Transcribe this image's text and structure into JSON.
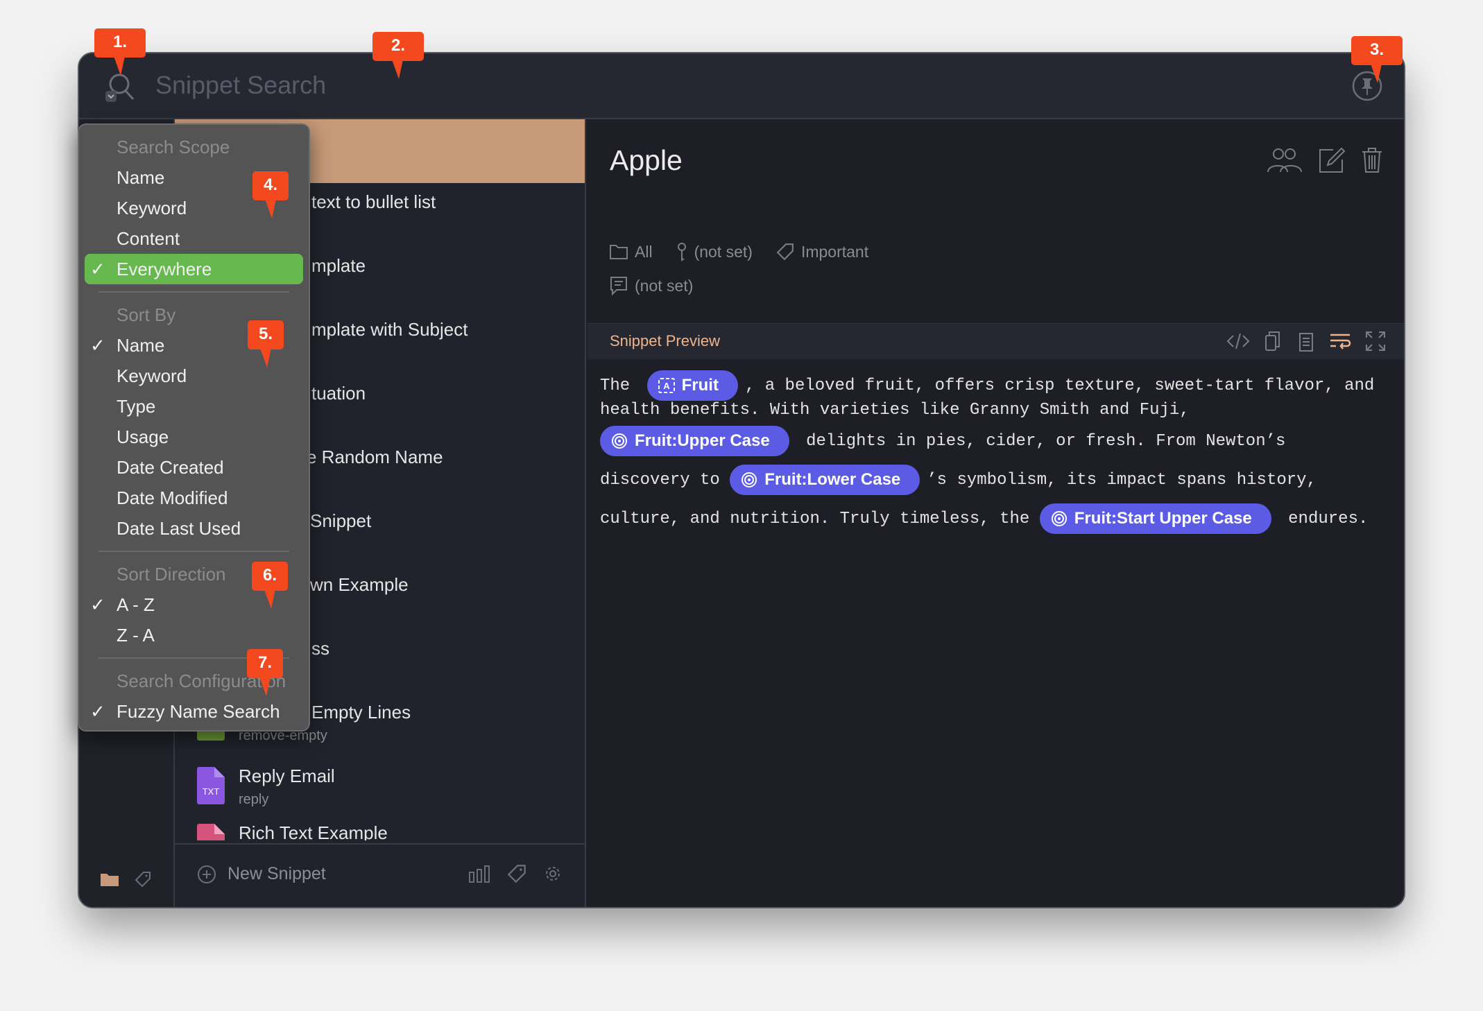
{
  "header": {
    "search_placeholder": "Snippet Search"
  },
  "list": {
    "items": [
      {
        "title": "",
        "selected": true
      },
      {
        "title": "text to bullet list"
      },
      {
        "title": "mplate"
      },
      {
        "title": "mplate with Subject"
      },
      {
        "title": "tuation"
      },
      {
        "title": "e Random Name"
      },
      {
        "title": "Snippet"
      },
      {
        "title": "wn Example"
      },
      {
        "title": "ss"
      },
      {
        "title": "Empty Lines",
        "subtitle": "remove-empty",
        "icon": "green-file-icon"
      },
      {
        "title": "Reply Email",
        "subtitle": "reply",
        "icon": "txt-file-icon",
        "icon_label": "TXT"
      },
      {
        "title": "Rich Text Example",
        "icon": "rich-text-file-icon"
      }
    ],
    "new_snippet": "New Snippet"
  },
  "detail": {
    "title": "Apple",
    "folder": "All",
    "keyword": "(not set)",
    "tag": "Important",
    "description": "(not set)",
    "preview_title": "Snippet Preview",
    "preview": {
      "l1a": "The ",
      "chip1": "Fruit",
      "l1b": ", a beloved fruit, offers crisp texture, sweet-tart flavor, and",
      "l2": "health benefits. With varieties like Granny Smith and Fuji,",
      "chip2": "Fruit:Upper Case",
      "l3b": " delights in pies, cider, or fresh. From Newton’s",
      "l4a": "discovery to ",
      "chip3": "Fruit:Lower Case",
      "l4b": "’s symbolism, its impact spans history,",
      "l5a": "culture, and nutrition. Truly timeless, the ",
      "chip4": "Fruit:Start Upper Case",
      "l5b": " endures."
    }
  },
  "menu": {
    "search_scope": "Search Scope",
    "scope": [
      "Name",
      "Keyword",
      "Content",
      "Everywhere"
    ],
    "sort_by": "Sort By",
    "sort": [
      "Name",
      "Keyword",
      "Type",
      "Usage",
      "Date Created",
      "Date Modified",
      "Date Last Used"
    ],
    "sort_direction": "Sort Direction",
    "direction": [
      "A - Z",
      "Z - A"
    ],
    "search_configuration": "Search Configuration",
    "config": [
      "Fuzzy Name Search"
    ],
    "check": "✓"
  },
  "callouts": [
    "1.",
    "2.",
    "3.",
    "4.",
    "5.",
    "6.",
    "7."
  ],
  "colors": {
    "accent": "#f0b48c",
    "selected_row": "#c79a79",
    "menu_highlight": "#67b84f",
    "chip": "#5b5be5",
    "callout": "#f4491f"
  }
}
